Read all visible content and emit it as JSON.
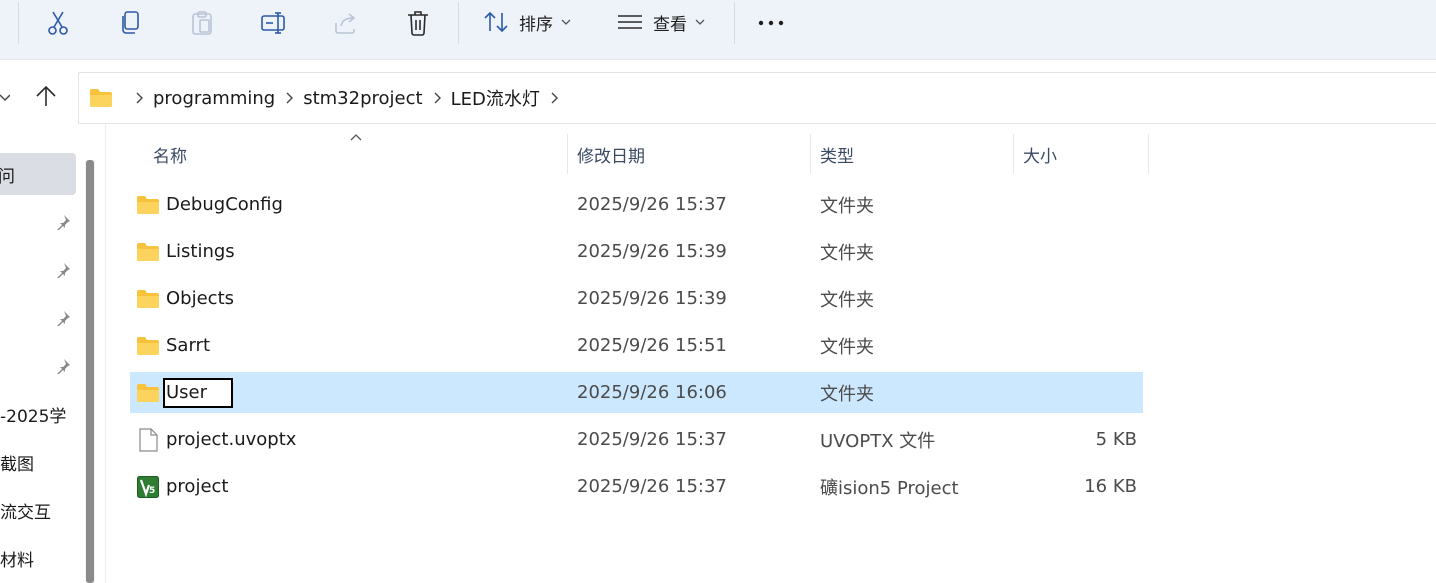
{
  "toolbar": {
    "sort_label": "排序",
    "view_label": "查看",
    "more_label": "···"
  },
  "address": {
    "crumbs": [
      "programming",
      "stm32project",
      "LED流水灯"
    ]
  },
  "sidebar": {
    "selected_label": "问",
    "items": [
      "-2025学",
      "截图",
      "流交互",
      "材料"
    ]
  },
  "list": {
    "columns": {
      "name": "名称",
      "date": "修改日期",
      "type": "类型",
      "size": "大小"
    },
    "rows": [
      {
        "name": "DebugConfig",
        "date": "2025/9/26 15:37",
        "type": "文件夹",
        "size": "",
        "icon": "folder-icon"
      },
      {
        "name": "Listings",
        "date": "2025/9/26 15:39",
        "type": "文件夹",
        "size": "",
        "icon": "folder-icon"
      },
      {
        "name": "Objects",
        "date": "2025/9/26 15:39",
        "type": "文件夹",
        "size": "",
        "icon": "folder-icon"
      },
      {
        "name": "Sarrt",
        "date": "2025/9/26 15:51",
        "type": "文件夹",
        "size": "",
        "icon": "folder-icon"
      },
      {
        "name": "User",
        "date": "2025/9/26 16:06",
        "type": "文件夹",
        "size": "",
        "icon": "folder-icon",
        "selected": true,
        "renaming": true
      },
      {
        "name": "project.uvoptx",
        "date": "2025/9/26 15:37",
        "type": "UVOPTX 文件",
        "size": "5 KB",
        "icon": "file-icon"
      },
      {
        "name": "project",
        "date": "2025/9/26 15:37",
        "type": "礦ision5 Project",
        "size": "16 KB",
        "icon": "keil-project-icon"
      }
    ]
  },
  "colors": {
    "selection": "#cce8ff",
    "toolbar_bg": "#eef2f9",
    "folder": "#f8c33c",
    "accent": "#1f5fbf"
  }
}
